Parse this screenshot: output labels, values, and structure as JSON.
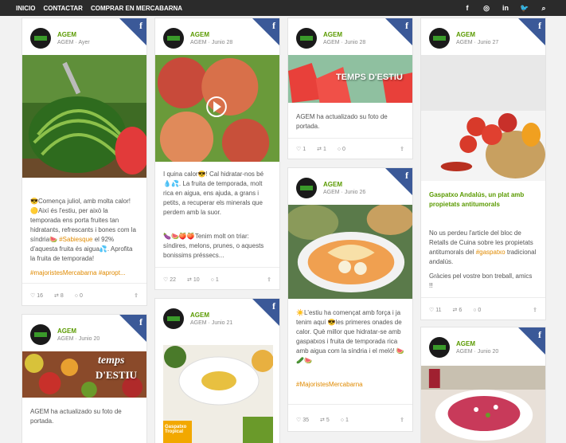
{
  "nav": {
    "items": [
      "INICIO",
      "CONTACTAR",
      "COMPRAR EN MERCABARNA"
    ]
  },
  "social": [
    "f",
    "◎",
    "in",
    "🐦",
    "⌕"
  ],
  "author": "AGEM",
  "fb_letter": "f",
  "cards": {
    "c1": {
      "meta": "AGEM · Ayer",
      "text": "😎Comença juliol, amb molta calor! 🟡Així és l'estiu, per això la temporada ens porta fruites tan hidratants, refrescants i bones com la síndria🍉 ",
      "tag1": "#Sabiesque",
      "text2": " el 92% d'aquesta fruita és aigua💦. Aprofita la fruita de temporada!",
      "tags": "#majoristesMercabarna #apropt...",
      "likes": "16",
      "shares": "8",
      "comments": "0"
    },
    "c2": {
      "meta": "AGEM · Junio 28",
      "text": "I quina calor😎! Cal hidratar-nos bé 💧💦. La fruita de temporada, molt rica en aigua, ens ajuda, a grans i petits, a recuperar els minerals que perdem amb la suor.",
      "text2": "🍆🍉🍑🍑Tenim molt on triar: síndires, melons, prunes, o aquests bonissims préssecs...",
      "likes": "22",
      "shares": "10",
      "comments": "1"
    },
    "c3": {
      "meta": "AGEM · Junio 28",
      "banner": "TEMPS D'ESTIU",
      "text": "AGEM ha actualizado su foto de portada.",
      "likes": "1",
      "shares": "1",
      "comments": "0"
    },
    "c4": {
      "meta": "AGEM · Junio 27",
      "title": "Gaspatxo Andalús, un plat amb propietats antitumorals",
      "text": "No us perdeu l'article del bloc de Retalls de Cuina sobre les propietats antitumorals del ",
      "tag1": "#gaspatxo",
      "text2": " tradicional andalús.",
      "text3": "Gràcies pel vostre bon treball, amics !!",
      "likes": "11",
      "shares": "6",
      "comments": "0"
    },
    "c5": {
      "meta": "AGEM · Junio 26",
      "text": "☀️L'estiu ha començat amb força i ja tenim aquí 😎les primeres onades de calor. Què millor que hidratar-se amb gaspatxos i fruita de temporada rica amb aigua com la síndria i el meló! 🍉🥒🍉",
      "tags": "#MajoristesMercabarna",
      "likes": "35",
      "shares": "5",
      "comments": "1"
    },
    "c6": {
      "meta": "AGEM · Junio 20",
      "banner1": "temps",
      "banner2": "D'ESTIU",
      "text": "AGEM ha actualizado su foto de portada."
    },
    "c7": {
      "meta": "AGEM · Junio 21",
      "label": "Gaspatxo Tropical"
    },
    "c8": {
      "meta": "AGEM · Junio 20"
    }
  },
  "colors": {
    "brand_green": "#5a9a00",
    "facebook": "#3b5998",
    "topbar": "#2b2b2b",
    "hashtag": "#e08a00"
  }
}
